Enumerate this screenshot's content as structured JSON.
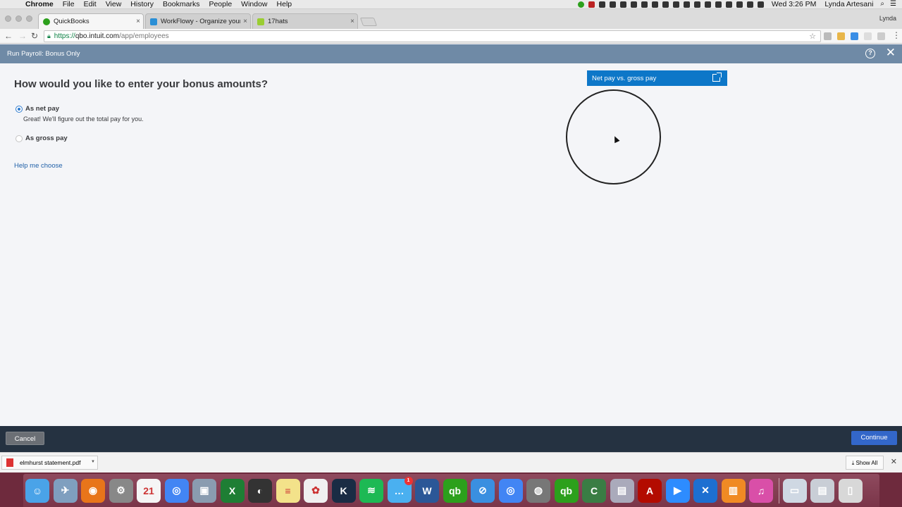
{
  "menubar": {
    "apple": "",
    "app": "Chrome",
    "items": [
      "File",
      "Edit",
      "View",
      "History",
      "Bookmarks",
      "People",
      "Window",
      "Help"
    ],
    "clock": "Wed 3:26 PM",
    "user": "Lynda Artesani"
  },
  "browser": {
    "tabs": [
      {
        "title": "QuickBooks",
        "active": true,
        "color": "#2ca01c"
      },
      {
        "title": "WorkFlowy - Organize your b",
        "active": false,
        "color": "#2a8fd6"
      },
      {
        "title": "17hats",
        "active": false,
        "color": "#9acd32"
      }
    ],
    "tab_close": "×",
    "profile": "Lynda",
    "url": {
      "scheme": "https://",
      "host": "qbo.intuit.com",
      "path": "/app/employees"
    }
  },
  "header": {
    "title": "Run Payroll: Bonus Only",
    "help": "?",
    "close": "✕"
  },
  "form": {
    "question": "How would you like to enter your bonus amounts?",
    "options": [
      {
        "label": "As net pay",
        "selected": true,
        "sub": "Great! We'll figure out the total pay for you."
      },
      {
        "label": "As gross pay",
        "selected": false
      }
    ],
    "help_link": "Help me choose"
  },
  "panel": {
    "title": "Net pay vs. gross pay"
  },
  "footer": {
    "cancel": "Cancel",
    "continue": "Continue"
  },
  "downloads": {
    "file": "elmhurst statement.pdf",
    "show_all": "Show All"
  },
  "dock": {
    "apps": [
      {
        "name": "finder",
        "color": "#4aa3e8",
        "glyph": "☺"
      },
      {
        "name": "preview",
        "color": "#7f9fbf",
        "glyph": "✈"
      },
      {
        "name": "firefox",
        "color": "#e8751a",
        "glyph": "◉"
      },
      {
        "name": "system-preferences",
        "color": "#888",
        "glyph": "⚙"
      },
      {
        "name": "calendar",
        "color": "#f5f5f5",
        "glyph": "21"
      },
      {
        "name": "chrome",
        "color": "#4285f4",
        "glyph": "◎"
      },
      {
        "name": "image-capture",
        "color": "#8a9cb0",
        "glyph": "▣"
      },
      {
        "name": "excel",
        "color": "#1e7e34",
        "glyph": "X"
      },
      {
        "name": "dashboard",
        "color": "#333",
        "glyph": "◐"
      },
      {
        "name": "notes",
        "color": "#f3e28a",
        "glyph": "≡"
      },
      {
        "name": "photos",
        "color": "#f0f0f0",
        "glyph": "✿"
      },
      {
        "name": "kindle",
        "color": "#1a2c44",
        "glyph": "K"
      },
      {
        "name": "spotify",
        "color": "#1db954",
        "glyph": "≋"
      },
      {
        "name": "messages",
        "color": "#4ab0f0",
        "glyph": "…"
      },
      {
        "name": "word",
        "color": "#2b5797",
        "glyph": "W"
      },
      {
        "name": "quickbooks",
        "color": "#2ca01c",
        "glyph": "qb"
      },
      {
        "name": "safari",
        "color": "#3a8fe0",
        "glyph": "⊘"
      },
      {
        "name": "chrome-alt",
        "color": "#4285f4",
        "glyph": "◎"
      },
      {
        "name": "dvd-player",
        "color": "#777",
        "glyph": "◍"
      },
      {
        "name": "quickbooks-alt",
        "color": "#2ca01c",
        "glyph": "qb"
      },
      {
        "name": "camtasia",
        "color": "#3a7d44",
        "glyph": "C"
      },
      {
        "name": "printer",
        "color": "#aab",
        "glyph": "▤"
      },
      {
        "name": "acrobat",
        "color": "#b30b00",
        "glyph": "A"
      },
      {
        "name": "zoom",
        "color": "#2d8cff",
        "glyph": "▶"
      },
      {
        "name": "xmind",
        "color": "#1d6fd1",
        "glyph": "✕"
      },
      {
        "name": "ibooks",
        "color": "#f08a24",
        "glyph": "▥"
      },
      {
        "name": "itunes",
        "color": "#d94fa8",
        "glyph": "♫"
      }
    ],
    "message_badge": "1",
    "right": [
      {
        "name": "documents-folder",
        "color": "#cfd8e3",
        "glyph": "▭"
      },
      {
        "name": "downloads-folder",
        "color": "#c9ced6",
        "glyph": "▤"
      },
      {
        "name": "trash",
        "color": "#d8d8d8",
        "glyph": "▯"
      }
    ]
  }
}
